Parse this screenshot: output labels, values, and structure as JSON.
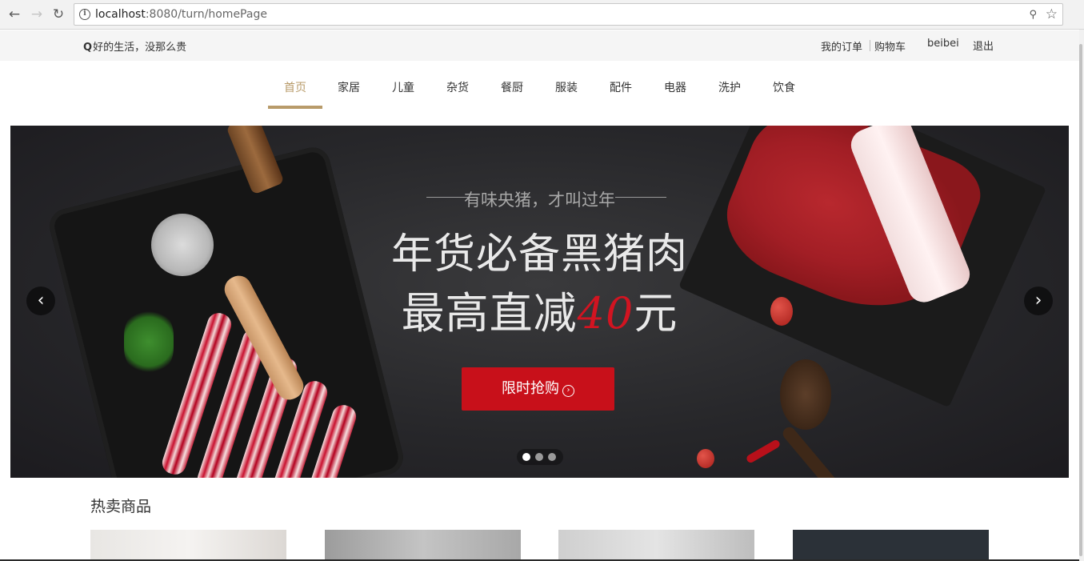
{
  "browser": {
    "url_host": "localhost",
    "url_rest": ":8080/turn/homePage",
    "icons": [
      "back-icon",
      "forward-icon",
      "reload-icon",
      "info-icon",
      "key-icon",
      "star-icon"
    ]
  },
  "topbar": {
    "slogan": "好的生活，没那么贵",
    "my_orders": "我的订单",
    "cart": "购物车",
    "username": "beibei",
    "logout": "退出"
  },
  "nav": {
    "items": [
      "首页",
      "家居",
      "儿童",
      "杂货",
      "餐厨",
      "服装",
      "配件",
      "电器",
      "洗护",
      "饮食"
    ],
    "active_index": 0,
    "accent_color": "#b89b6a"
  },
  "banner": {
    "tagline": "有味央猪，才叫过年",
    "headline1": "年货必备黑猪肉",
    "headline2_prefix": "最高直减",
    "headline2_number": "40",
    "headline2_suffix": "元",
    "cta_label": "限时抢购",
    "cta_color": "#c8101a",
    "slide_count": 3,
    "active_slide": 0
  },
  "hot": {
    "title": "热卖商品",
    "product_count": 4
  }
}
